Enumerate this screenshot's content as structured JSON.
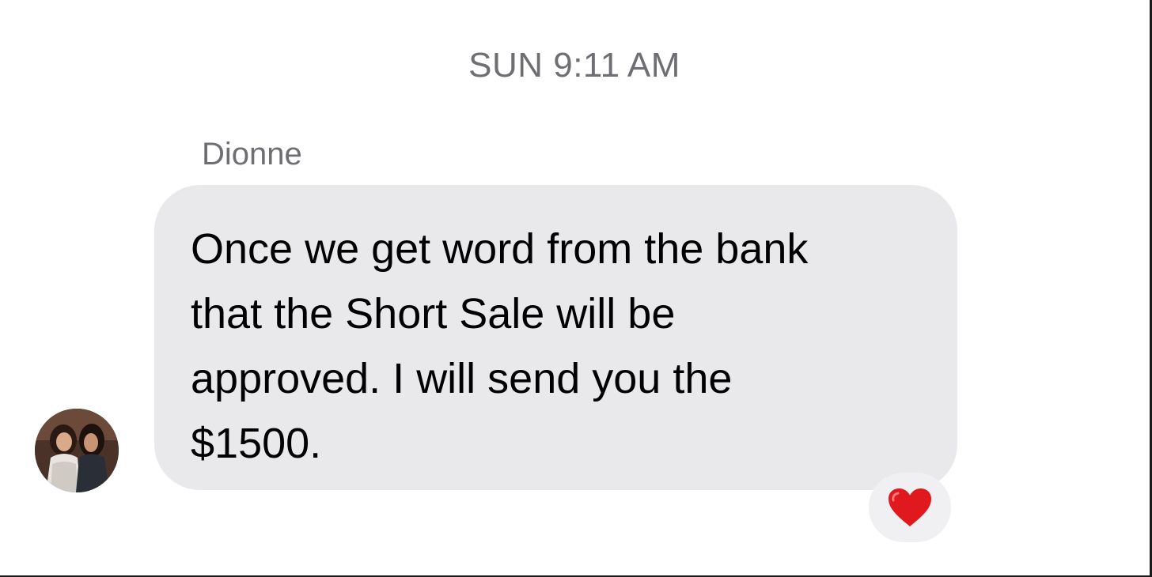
{
  "thread": {
    "timestamp": "SUN 9:11 AM"
  },
  "message": {
    "sender": "Dionne",
    "text": "Once we get word from the bank\nthat the Short Sale will be\napproved. I will send you the\n$1500.",
    "avatar_icon": "contact-photo",
    "reaction_icon": "red-heart-icon",
    "reaction_color": "#e0191e",
    "bubble_color": "#e9e9eb"
  }
}
